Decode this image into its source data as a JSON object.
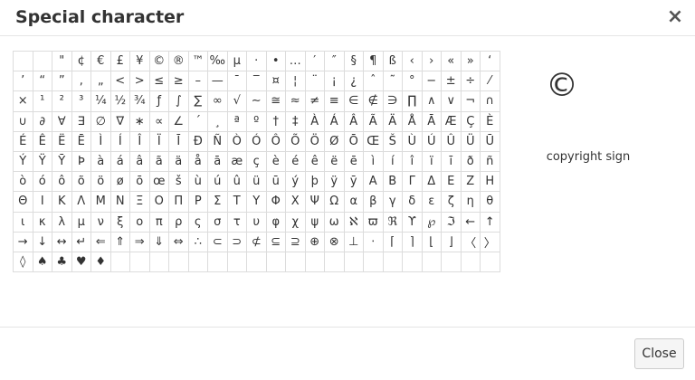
{
  "dialog": {
    "title": "Special character",
    "close_icon": "×",
    "close_button_label": "Close"
  },
  "preview": {
    "char": "©",
    "name": "copyright sign"
  },
  "characters": [
    [
      "",
      "",
      "\"",
      "¢",
      "€",
      "£",
      "¥",
      "©",
      "®",
      "™",
      "‰",
      "µ",
      "·",
      "•",
      "…",
      "′",
      "″",
      "§",
      "¶",
      "ß",
      "‹",
      "›",
      "«",
      "»",
      "‘"
    ],
    [
      "’",
      "“",
      "”",
      "‚",
      "„",
      "<",
      ">",
      "≤",
      "≥",
      "–",
      "—",
      "¯",
      "‾",
      "¤",
      "¦",
      "¨",
      "¡",
      "¿",
      "ˆ",
      "˜",
      "°",
      "−",
      "±",
      "÷",
      "⁄"
    ],
    [
      "×",
      "¹",
      "²",
      "³",
      "¼",
      "½",
      "¾",
      "ƒ",
      "∫",
      "∑",
      "∞",
      "√",
      "∼",
      "≅",
      "≈",
      "≠",
      "≡",
      "∈",
      "∉",
      "∋",
      "∏",
      "∧",
      "∨",
      "¬",
      "∩"
    ],
    [
      "∪",
      "∂",
      "∀",
      "∃",
      "∅",
      "∇",
      "∗",
      "∝",
      "∠",
      "´",
      "¸",
      "ª",
      "º",
      "†",
      "‡",
      "À",
      "Á",
      "Â",
      "Ã",
      "Ä",
      "Å",
      "Ā",
      "Æ",
      "Ç",
      "È"
    ],
    [
      "É",
      "Ê",
      "Ë",
      "Ē",
      "Ì",
      "Í",
      "Î",
      "Ï",
      "Ī",
      "Ð",
      "Ñ",
      "Ò",
      "Ó",
      "Ô",
      "Õ",
      "Ö",
      "Ø",
      "Ō",
      "Œ",
      "Š",
      "Ù",
      "Ú",
      "Û",
      "Ü",
      "Ū"
    ],
    [
      "Ý",
      "Ÿ",
      "Ȳ",
      "Þ",
      "à",
      "á",
      "â",
      "ã",
      "ä",
      "å",
      "ā",
      "æ",
      "ç",
      "è",
      "é",
      "ê",
      "ë",
      "ē",
      "ì",
      "í",
      "î",
      "ï",
      "ī",
      "ð",
      "ñ"
    ],
    [
      "ò",
      "ó",
      "ô",
      "õ",
      "ö",
      "ø",
      "ō",
      "œ",
      "š",
      "ù",
      "ú",
      "û",
      "ü",
      "ū",
      "ý",
      "þ",
      "ÿ",
      "ȳ",
      "Α",
      "Β",
      "Γ",
      "Δ",
      "Ε",
      "Ζ",
      "Η"
    ],
    [
      "Θ",
      "Ι",
      "Κ",
      "Λ",
      "Μ",
      "Ν",
      "Ξ",
      "Ο",
      "Π",
      "Ρ",
      "Σ",
      "Τ",
      "Υ",
      "Φ",
      "Χ",
      "Ψ",
      "Ω",
      "α",
      "β",
      "γ",
      "δ",
      "ε",
      "ζ",
      "η",
      "θ"
    ],
    [
      "ι",
      "κ",
      "λ",
      "μ",
      "ν",
      "ξ",
      "ο",
      "π",
      "ρ",
      "ς",
      "σ",
      "τ",
      "υ",
      "φ",
      "χ",
      "ψ",
      "ω",
      "ℵ",
      "ϖ",
      "ℜ",
      "ϒ",
      "℘",
      "ℑ",
      "←",
      "↑"
    ],
    [
      "→",
      "↓",
      "↔",
      "↵",
      "⇐",
      "⇑",
      "⇒",
      "⇓",
      "⇔",
      "∴",
      "⊂",
      "⊃",
      "⊄",
      "⊆",
      "⊇",
      "⊕",
      "⊗",
      "⊥",
      "⋅",
      "⌈",
      "⌉",
      "⌊",
      "⌋",
      "〈",
      "〉"
    ],
    [
      "◊",
      "♠",
      "♣",
      "♥",
      "♦",
      "",
      "",
      "",
      "",
      "",
      "",
      "",
      "",
      "",
      "",
      "",
      "",
      "",
      "",
      "",
      "",
      "",
      "",
      "",
      ""
    ]
  ]
}
